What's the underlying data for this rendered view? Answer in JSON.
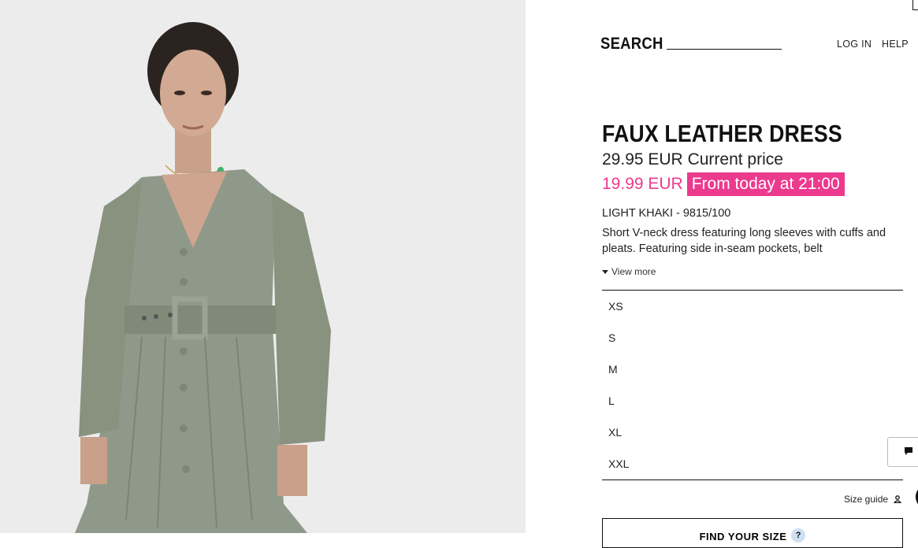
{
  "header": {
    "search_label": "SEARCH",
    "search_value": "",
    "login_label": "LOG IN",
    "help_label": "HELP"
  },
  "product": {
    "title": "FAUX LEATHER DRESS",
    "current_price": "29.95 EUR",
    "current_price_label": "Current price",
    "sale_price": "19.99 EUR",
    "sale_badge": "From today at 21:00",
    "color_ref": "LIGHT KHAKI - 9815/100",
    "description": "Short V-neck dress featuring long sleeves with cuffs and pleats. Featuring side in-seam pockets, belt",
    "view_more_label": "View more",
    "sizes": [
      "XS",
      "S",
      "M",
      "L",
      "XL",
      "XXL"
    ],
    "size_guide_label": "Size guide",
    "find_size_label": "FIND YOUR SIZE",
    "find_size_help": "?"
  },
  "icons": {
    "view_more": "caret-down-icon",
    "size_guide": "person-icon",
    "find_size_help": "question-icon",
    "chat": "chat-icon"
  },
  "colors": {
    "sale_accent": "#ec3a8e",
    "text": "#111111",
    "photo_bg": "#ececec",
    "dress": "#8f998a"
  }
}
